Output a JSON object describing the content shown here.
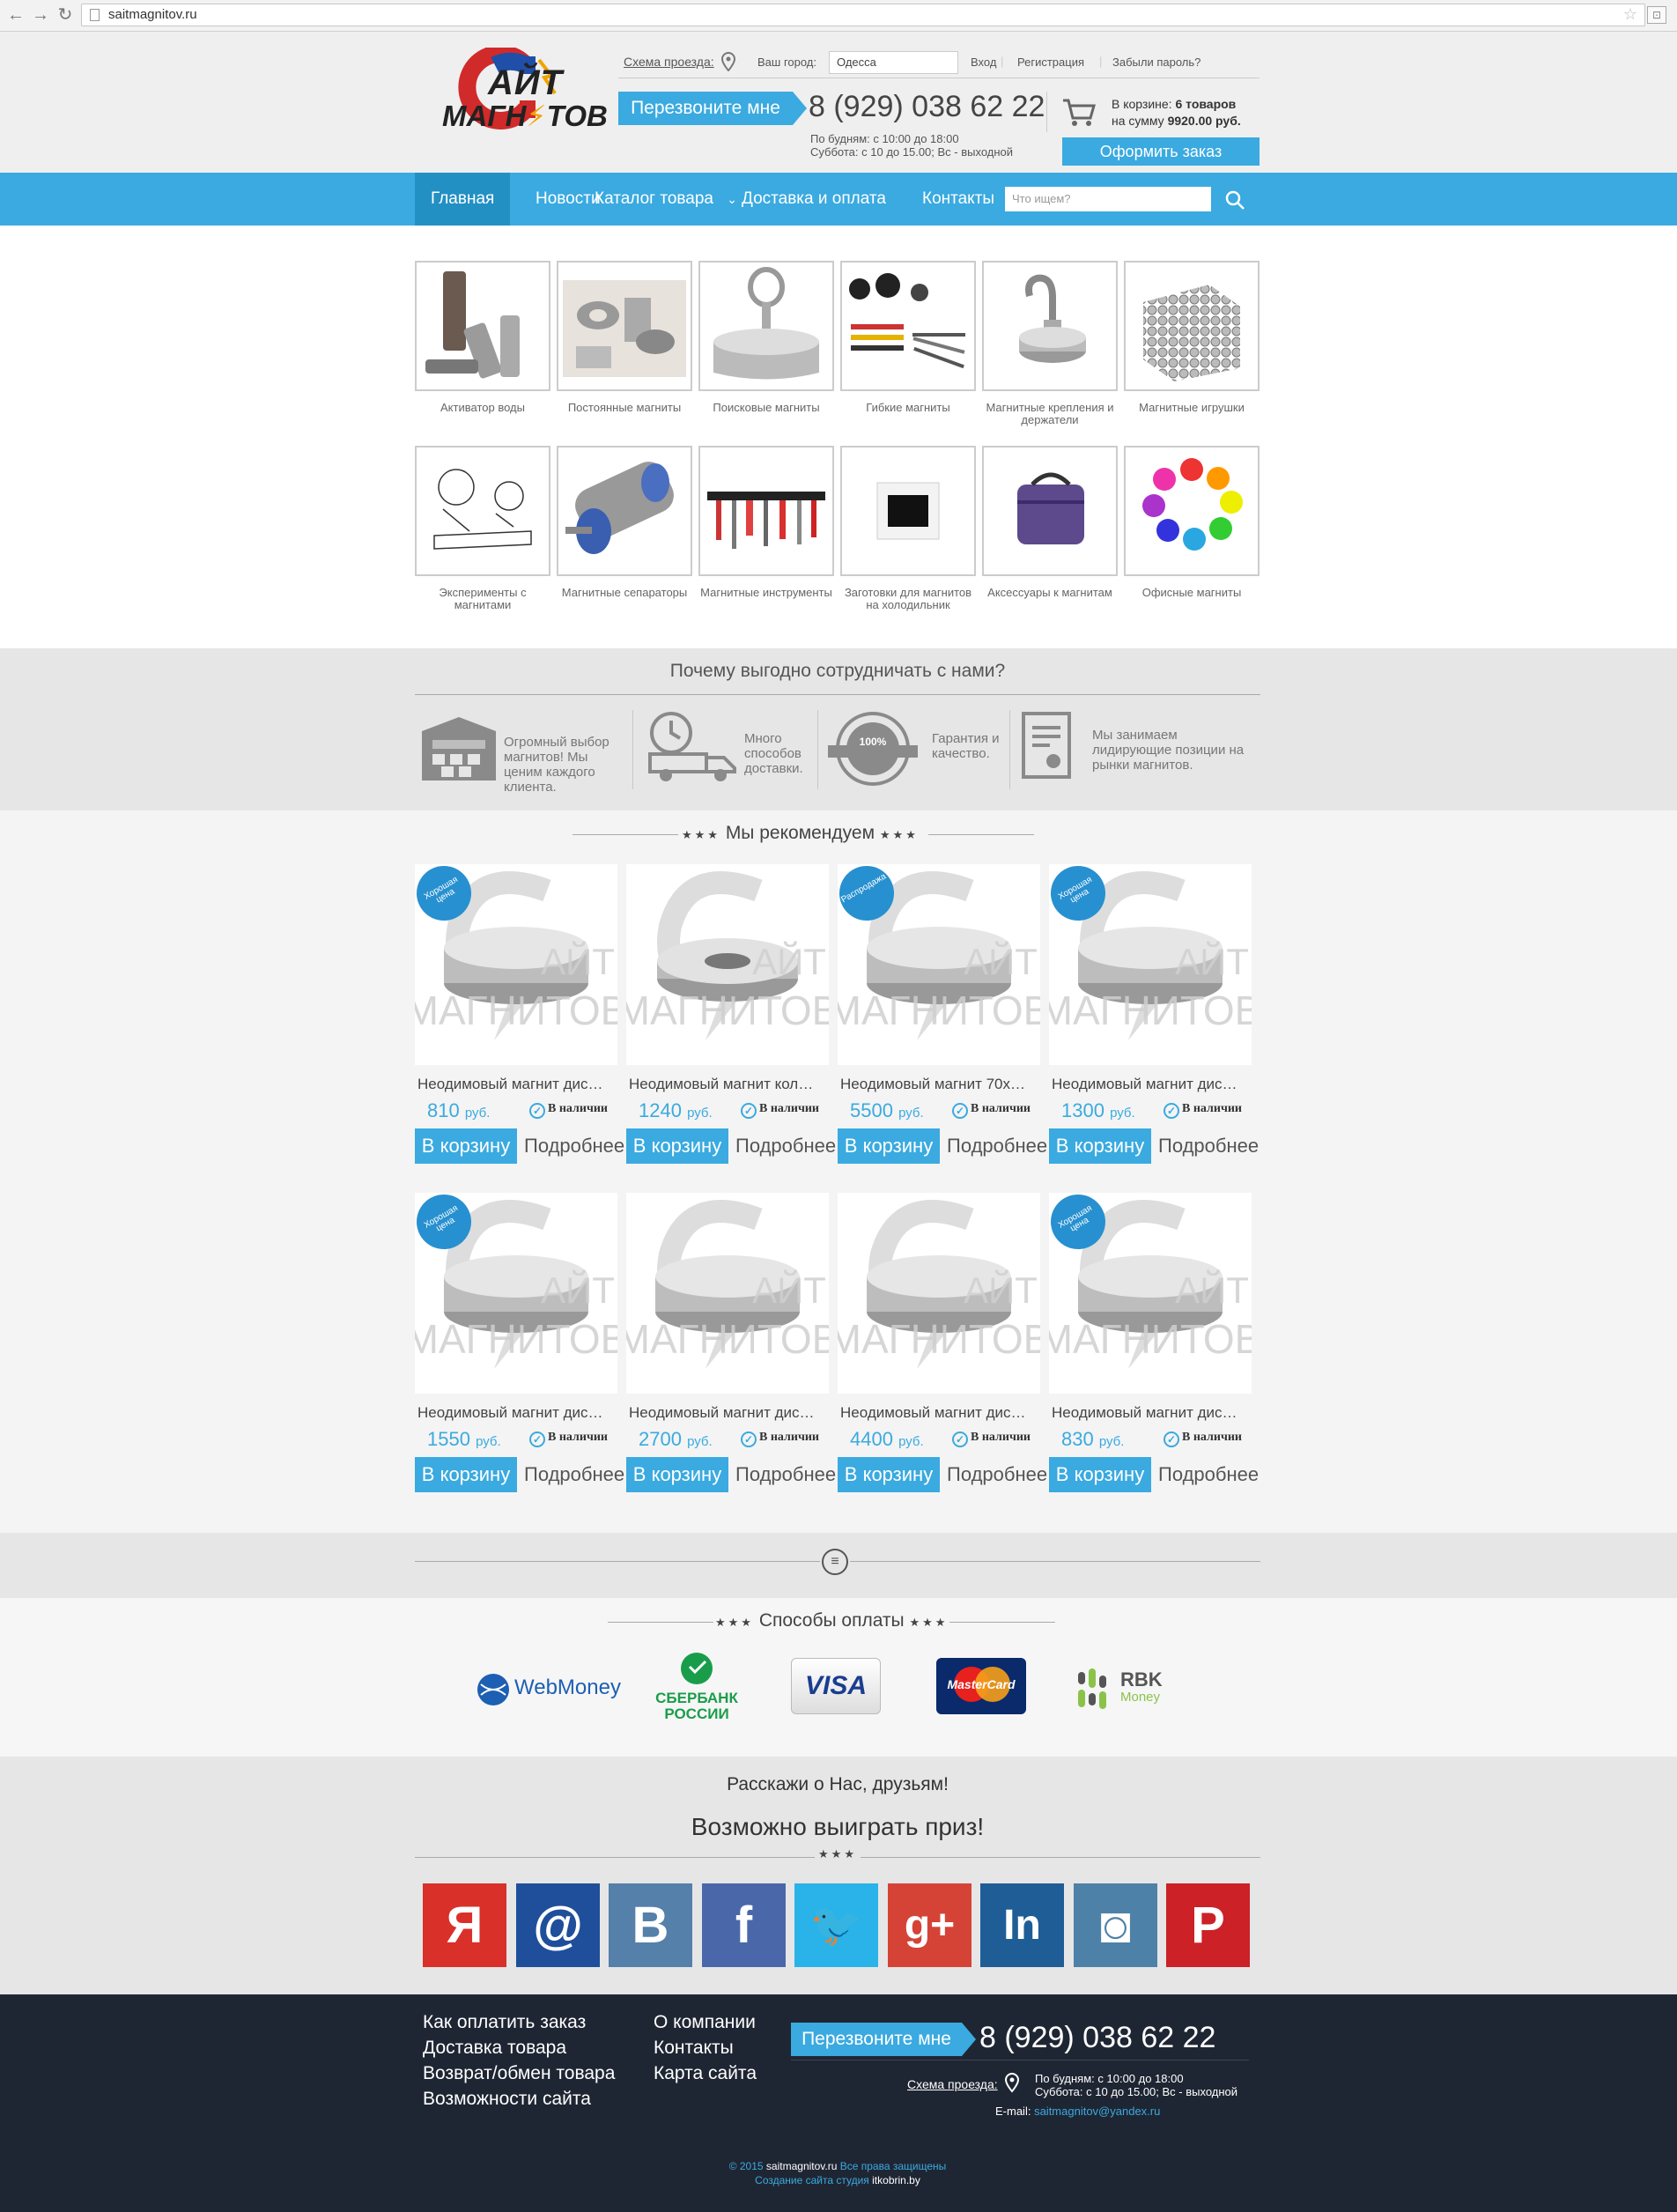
{
  "browser": {
    "url": "saitmagnitov.ru"
  },
  "header": {
    "logo_line1": "АЙТ",
    "logo_line2": "МАГН",
    "logo_line3": "ТОВ",
    "route_link": "Схема проезда:",
    "city_label": "Ваш город:",
    "city_value": "Одесса",
    "login": "Вход",
    "register": "Регистрация",
    "forgot": "Забыли пароль?",
    "callback": "Перезвоните мне",
    "phone": "8 (929) 038 62 22",
    "hours1": "По будням: с 10:00 до 18:00",
    "hours2": "Суббота: с 10 до 15.00; Вс - выходной",
    "cart_prefix": "В корзине:",
    "cart_count": "6 товаров",
    "cart_sum_prefix": "на сумму",
    "cart_sum": "9920.00 руб.",
    "order_button": "Оформить заказ"
  },
  "nav": {
    "items": [
      "Главная",
      "Новости",
      "Каталог товара",
      "Доставка и оплата",
      "Контакты"
    ],
    "search_placeholder": "Что ищем?"
  },
  "categories": [
    {
      "label": "Активатор воды"
    },
    {
      "label": "Постоянные магниты"
    },
    {
      "label": "Поисковые магниты"
    },
    {
      "label": "Гибкие магниты"
    },
    {
      "label": "Магнитные крепления и держатели"
    },
    {
      "label": "Магнитные игрушки"
    },
    {
      "label": "Эксперименты с магнитами"
    },
    {
      "label": "Магнитные сепараторы"
    },
    {
      "label": "Магнитные инструменты"
    },
    {
      "label": "Заготовки для магнитов на холодильник"
    },
    {
      "label": "Аксессуары к магнитам"
    },
    {
      "label": "Офисные магниты"
    }
  ],
  "why": {
    "title": "Почему выгодно сотрудничать с нами?",
    "items": [
      "Огромный выбор магнитов! Мы ценим каждого клиента.",
      "Много способов доставки.",
      "Гарантия и качество.",
      "Мы занимаем лидирующие позиции на рынки магнитов."
    ],
    "badge_text": "100%"
  },
  "recommend": {
    "title": "Мы рекомендуем",
    "stars": "★★★",
    "to_cart": "В корзину",
    "more": "Подробнее",
    "in_stock": "В наличии",
    "currency": "руб.",
    "watermark1": "АЙТ",
    "watermark2": "МАГНИТОВ",
    "products": [
      {
        "name": "Неодимовый магнит дис…",
        "price": "810",
        "badge": "Хорошая цена"
      },
      {
        "name": "Неодимовый магнит кол…",
        "price": "1240",
        "badge": ""
      },
      {
        "name": "Неодимовый магнит 70х…",
        "price": "5500",
        "badge": "Распродажа"
      },
      {
        "name": "Неодимовый магнит дис…",
        "price": "1300",
        "badge": "Хорошая цена"
      },
      {
        "name": "Неодимовый магнит дис…",
        "price": "1550",
        "badge": "Хорошая цена"
      },
      {
        "name": "Неодимовый магнит дис…",
        "price": "2700",
        "badge": ""
      },
      {
        "name": "Неодимовый магнит дис…",
        "price": "4400",
        "badge": ""
      },
      {
        "name": "Неодимовый магнит дис…",
        "price": "830",
        "badge": "Хорошая цена"
      }
    ]
  },
  "payment": {
    "title": "Способы оплаты",
    "webmoney": "WebMoney",
    "sber1": "СБЕРБАНК",
    "sber2": "РОССИИ",
    "visa": "VISA",
    "mastercard": "MasterCard",
    "rbk1": "RBK",
    "rbk2": "Money"
  },
  "share": {
    "line1": "Расскажи о Нас, друзьям!",
    "line2": "Возможно выиграть приз!",
    "networks": [
      {
        "name": "yandex",
        "glyph": "Я",
        "color": "#d9302a"
      },
      {
        "name": "mailru",
        "glyph": "@",
        "color": "#1f4f9b"
      },
      {
        "name": "vk",
        "glyph": "B",
        "color": "#5480aa"
      },
      {
        "name": "facebook",
        "glyph": "f",
        "color": "#4a68a9"
      },
      {
        "name": "twitter",
        "glyph": "🐦",
        "color": "#29b3e9"
      },
      {
        "name": "googleplus",
        "glyph": "g+",
        "color": "#d54337"
      },
      {
        "name": "linkedin",
        "glyph": "In",
        "color": "#1f5d97"
      },
      {
        "name": "instagram",
        "glyph": "◙",
        "color": "#4e81a7"
      },
      {
        "name": "pinterest",
        "glyph": "P",
        "color": "#cb2127"
      }
    ]
  },
  "footer": {
    "col1": [
      "Как оплатить заказ",
      "Доставка товара",
      "Возврат/обмен товара",
      "Возможности сайта"
    ],
    "col2": [
      "О компании",
      "Контакты",
      "Карта сайта"
    ],
    "callback": "Перезвоните мне",
    "phone": "8 (929) 038 62 22",
    "route": "Схема проезда:",
    "hours1": "По будням: с 10:00 до 18:00",
    "hours2": "Суббота: с 10 до 15.00; Вс - выходной",
    "email_label": "E-mail:",
    "email": "saitmagnitov@yandex.ru",
    "copy_prefix": "© 2015",
    "copy_site": "saitmagnitov.ru",
    "copy_suffix": "Все права защищены",
    "studio_prefix": "Создание сайта студия",
    "studio": "itkobrin.by"
  },
  "colors": {
    "accent": "#3aaae0",
    "accent_dark": "#2390c4",
    "footer_bg": "#1f2633"
  }
}
